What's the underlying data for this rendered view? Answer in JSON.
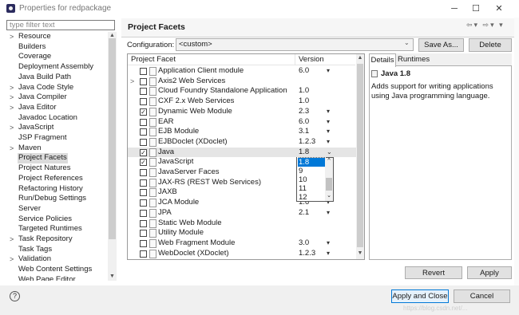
{
  "window": {
    "title": "Properties for redpackage",
    "min": "─",
    "max": "☐",
    "close": "✕"
  },
  "left": {
    "filter_placeholder": "type filter text",
    "tree": [
      {
        "label": "Resource",
        "arrow": ">"
      },
      {
        "label": "Builders",
        "arrow": ""
      },
      {
        "label": "Coverage",
        "arrow": ""
      },
      {
        "label": "Deployment Assembly",
        "arrow": ""
      },
      {
        "label": "Java Build Path",
        "arrow": ""
      },
      {
        "label": "Java Code Style",
        "arrow": ">"
      },
      {
        "label": "Java Compiler",
        "arrow": ">"
      },
      {
        "label": "Java Editor",
        "arrow": ">"
      },
      {
        "label": "Javadoc Location",
        "arrow": ""
      },
      {
        "label": "JavaScript",
        "arrow": ">"
      },
      {
        "label": "JSP Fragment",
        "arrow": ""
      },
      {
        "label": "Maven",
        "arrow": ">"
      },
      {
        "label": "Project Facets",
        "arrow": "",
        "selected": true
      },
      {
        "label": "Project Natures",
        "arrow": ""
      },
      {
        "label": "Project References",
        "arrow": ""
      },
      {
        "label": "Refactoring History",
        "arrow": ""
      },
      {
        "label": "Run/Debug Settings",
        "arrow": ""
      },
      {
        "label": "Server",
        "arrow": ""
      },
      {
        "label": "Service Policies",
        "arrow": ""
      },
      {
        "label": "Targeted Runtimes",
        "arrow": ""
      },
      {
        "label": "Task Repository",
        "arrow": ">"
      },
      {
        "label": "Task Tags",
        "arrow": ""
      },
      {
        "label": "Validation",
        "arrow": ">"
      },
      {
        "label": "Web Content Settings",
        "arrow": ""
      },
      {
        "label": "Web Page Editor",
        "arrow": ""
      }
    ]
  },
  "main": {
    "title": "Project Facets",
    "nav": "⇦▾ ⇨▾ ▾",
    "config_label": "Configuration:",
    "config_value": "<custom>",
    "save_as": "Save As...",
    "delete": "Delete",
    "col_facet": "Project Facet",
    "col_version": "Version",
    "facets": [
      {
        "name": "Application Client module",
        "version": "6.0",
        "dd": true,
        "checked": false,
        "arrow": ""
      },
      {
        "name": "Axis2 Web Services",
        "version": "",
        "dd": false,
        "checked": false,
        "arrow": ">"
      },
      {
        "name": "Cloud Foundry Standalone Application",
        "version": "1.0",
        "dd": false,
        "checked": false,
        "arrow": ""
      },
      {
        "name": "CXF 2.x Web Services",
        "version": "1.0",
        "dd": false,
        "checked": false,
        "arrow": ""
      },
      {
        "name": "Dynamic Web Module",
        "version": "2.3",
        "dd": true,
        "checked": true,
        "arrow": ""
      },
      {
        "name": "EAR",
        "version": "6.0",
        "dd": true,
        "checked": false,
        "arrow": ""
      },
      {
        "name": "EJB Module",
        "version": "3.1",
        "dd": true,
        "checked": false,
        "arrow": ""
      },
      {
        "name": "EJBDoclet (XDoclet)",
        "version": "1.2.3",
        "dd": true,
        "checked": false,
        "arrow": ""
      },
      {
        "name": "Java",
        "version": "1.8",
        "dd": true,
        "checked": true,
        "arrow": "",
        "highlight": true
      },
      {
        "name": "JavaScript",
        "version": "",
        "dd": false,
        "checked": true,
        "arrow": ""
      },
      {
        "name": "JavaServer Faces",
        "version": "",
        "dd": false,
        "checked": false,
        "arrow": ""
      },
      {
        "name": "JAX-RS (REST Web Services)",
        "version": "",
        "dd": false,
        "checked": false,
        "arrow": ""
      },
      {
        "name": "JAXB",
        "version": "",
        "dd": false,
        "checked": false,
        "arrow": ""
      },
      {
        "name": "JCA Module",
        "version": "1.6",
        "dd": true,
        "checked": false,
        "arrow": ""
      },
      {
        "name": "JPA",
        "version": "2.1",
        "dd": true,
        "checked": false,
        "arrow": ""
      },
      {
        "name": "Static Web Module",
        "version": "",
        "dd": false,
        "checked": false,
        "arrow": ""
      },
      {
        "name": "Utility Module",
        "version": "",
        "dd": false,
        "checked": false,
        "arrow": ""
      },
      {
        "name": "Web Fragment Module",
        "version": "3.0",
        "dd": true,
        "checked": false,
        "arrow": ""
      },
      {
        "name": "WebDoclet (XDoclet)",
        "version": "1.2.3",
        "dd": true,
        "checked": false,
        "arrow": ""
      }
    ],
    "version_options": [
      "1.8",
      "9",
      "10",
      "11",
      "12"
    ],
    "version_selected": "1.8",
    "tab_details": "Details",
    "tab_runtimes": "Runtimes",
    "detail_title": "Java 1.8",
    "detail_desc": "Adds support for writing applications using Java programming language.",
    "revert": "Revert",
    "apply": "Apply"
  },
  "footer": {
    "help": "?",
    "apply_close": "Apply and Close",
    "cancel": "Cancel",
    "watermark": "https://blog.csdn.net/..."
  }
}
